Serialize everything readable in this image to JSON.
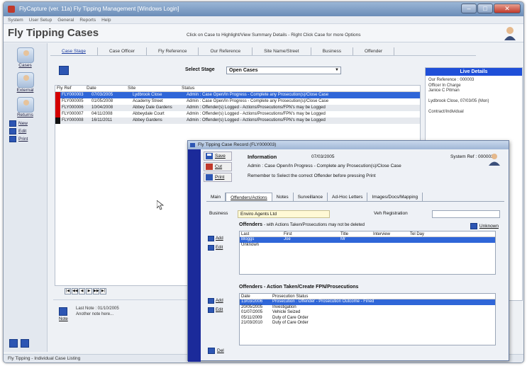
{
  "window": {
    "title": "FlyCapture (ver. 11a) Fly Tipping Management [Windows Login]"
  },
  "menu": [
    "System",
    "User Setup",
    "General",
    "Reports",
    "Help"
  ],
  "header": {
    "app_title": "Fly Tipping Cases",
    "hint": "Click on Case to Highlight/View Summary Details - Right Click Case for more Options"
  },
  "sidebar": {
    "big_buttons": [
      {
        "label": "Cases"
      },
      {
        "label": "External"
      },
      {
        "label": "Returns"
      }
    ],
    "small_buttons": [
      {
        "label": "New"
      },
      {
        "label": "Edit"
      },
      {
        "label": "Print"
      }
    ]
  },
  "tabs": [
    "Case Stage",
    "Case Officer",
    "Fly Reference",
    "Our Reference",
    "Site Name/Street",
    "Business",
    "Offender"
  ],
  "stage": {
    "label": "Select Stage",
    "value": "Open Cases"
  },
  "grid": {
    "headers": [
      "Fly Ref",
      "Date",
      "Site",
      "Status"
    ],
    "rows": [
      {
        "ref": "FLY000003",
        "date": "07/03/2005",
        "site": "Lydbrook Close",
        "status": "Admin : Case Open/In Progress - Complete any Prosecution(s)/Close Case",
        "color": "#d40000",
        "selected": true
      },
      {
        "ref": "FLY000005",
        "date": "01/05/2008",
        "site": "Academy Street",
        "status": "Admin : Case Open/In Progress - Complete any Prosecution(s)/Close Case",
        "color": "#d40000",
        "selected": false
      },
      {
        "ref": "FLY000006",
        "date": "10/04/2008",
        "site": "Abbey Dale Gardens",
        "status": "Admin : Offender(s) Logged - Actions/Prosecutions/FPN's may be Logged",
        "color": "#d40000",
        "selected": false
      },
      {
        "ref": "FLY000007",
        "date": "04/11/2008",
        "site": "Abbeydale Court",
        "status": "Admin : Offender(s) Logged - Actions/Prosecutions/FPN's may be Logged",
        "color": "#d40000",
        "selected": false
      },
      {
        "ref": "FLY000008",
        "date": "16/11/2011",
        "site": "Abbey Gardens",
        "status": "Admin : Offender(s) Logged - Actions/Prosecutions/FPN's may be Logged",
        "color": "#111111",
        "selected": false
      }
    ]
  },
  "notes": {
    "button": "Note",
    "last_note": "Last Note : 01/10/2005",
    "text": "Another note here..."
  },
  "live": {
    "title": "Live Details",
    "lines": [
      "Our Reference : 000003",
      "Officer In Charge",
      "Janice C Pitman",
      "",
      "Lydbrook Close, 07/03/05 (Mon)",
      "",
      "Contract/Individual"
    ]
  },
  "status_bar": "Fly Tipping - Individual Case Listing",
  "dialog": {
    "title": "Fly Tipping Case Record (FLY000003)",
    "buttons": [
      "Save",
      "Cut",
      "Print"
    ],
    "info_title": "Information",
    "info_date": "07/03/2005",
    "system_ref": "System Ref : 000003",
    "status": "Admin : Case Open/In Progress - Complete any Prosecution(s)/Close Case",
    "reminder": "Remember to Select the correct Offender before pressing Print",
    "tabs": [
      "Main",
      "Offenders/Actions",
      "Notes",
      "Surveillance",
      "Ad-Hoc Letters",
      "Images/Docs/Mapping"
    ],
    "business_label": "Business",
    "business_value": "Enviro Agents Ltd",
    "veh_label": "Veh Registration",
    "veh_value": "",
    "offenders_title": "Offenders",
    "offenders_sub": "- with Actions Taken/Prosecutions may not be deleted",
    "unknown": "Unknown",
    "offenders_headers": [
      "Last",
      "First",
      "Title",
      "Interview",
      "Tel Day"
    ],
    "offenders": [
      [
        "Bloggs",
        "Joe",
        "Mr",
        "",
        ""
      ],
      [
        "Unknown",
        "",
        "",
        "",
        ""
      ]
    ],
    "offender_buttons": [
      "Add",
      "Edit"
    ],
    "actions_title": "Offenders - Action Taken/Create FPN/Prosecutions",
    "actions_headers": [
      "Date",
      "Prosecution Status"
    ],
    "actions": [
      [
        "13/03/2006",
        "Prosecution : Offender - Prosecution Outcome - Fined"
      ],
      [
        "20/05/2005",
        "Investigation"
      ],
      [
        "01/07/2005",
        "Vehicle Seized"
      ],
      [
        "05/11/2009",
        "Duty of Care Order"
      ],
      [
        "21/03/2010",
        "Duty of Care Order"
      ]
    ],
    "action_buttons": [
      "Add",
      "Edit"
    ],
    "delete": "Del"
  }
}
